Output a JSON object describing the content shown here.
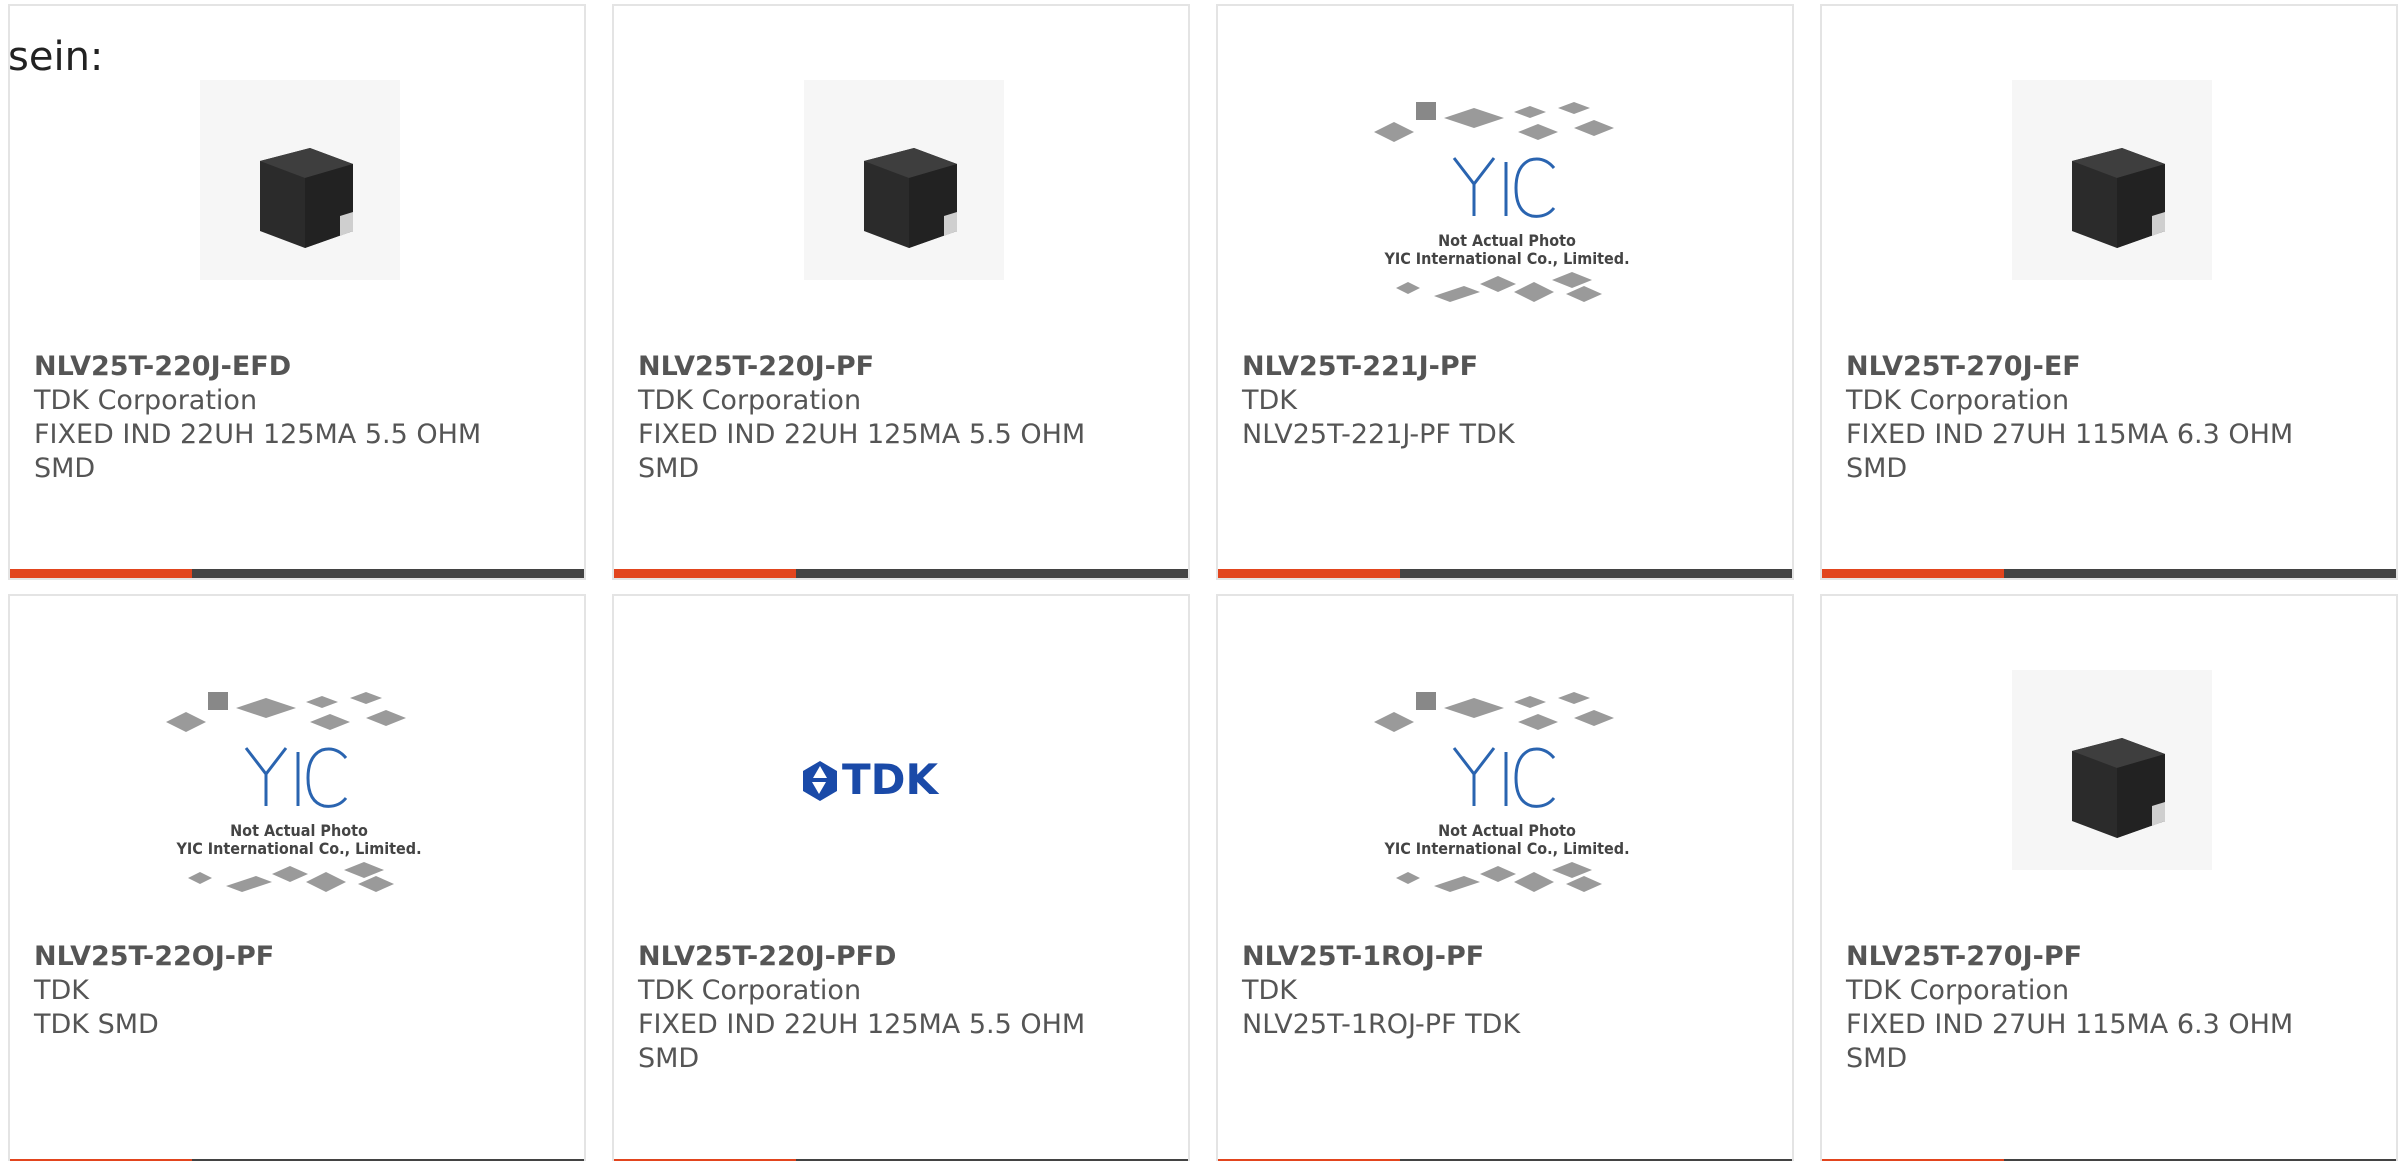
{
  "intro_text": "sein:",
  "accent_color": "#e2451e",
  "bar_color": "#434343",
  "cards": [
    {
      "part": "NLV25T-220J-EFD",
      "maker": "TDK Corporation",
      "desc": "FIXED IND 22UH 125MA 5.5 OHM SMD",
      "image": "inductor-chip-photo"
    },
    {
      "part": "NLV25T-220J-PF",
      "maker": "TDK Corporation",
      "desc": "FIXED IND 22UH 125MA 5.5 OHM SMD",
      "image": "inductor-chip-photo"
    },
    {
      "part": "NLV25T-221J-PF",
      "maker": "TDK",
      "desc": "NLV25T-221J-PF TDK",
      "image": "yic-placeholder",
      "placeholder_line1": "Not Actual Photo",
      "placeholder_line2": "YIC International Co., Limited."
    },
    {
      "part": "NLV25T-270J-EF",
      "maker": "TDK Corporation",
      "desc": "FIXED IND 27UH 115MA 6.3 OHM SMD",
      "image": "inductor-chip-photo"
    },
    {
      "part": "NLV25T-22OJ-PF",
      "maker": "TDK",
      "desc": "TDK SMD",
      "image": "yic-placeholder",
      "placeholder_line1": "Not Actual Photo",
      "placeholder_line2": "YIC International Co., Limited."
    },
    {
      "part": "NLV25T-220J-PFD",
      "maker": "TDK Corporation",
      "desc": "FIXED IND 22UH 125MA 5.5 OHM SMD",
      "image": "tdk-logo",
      "logo_text": "TDK"
    },
    {
      "part": "NLV25T-1ROJ-PF",
      "maker": "TDK",
      "desc": "NLV25T-1ROJ-PF TDK",
      "image": "yic-placeholder",
      "placeholder_line1": "Not Actual Photo",
      "placeholder_line2": "YIC International Co., Limited."
    },
    {
      "part": "NLV25T-270J-PF",
      "maker": "TDK Corporation",
      "desc": "FIXED IND 27UH 115MA 6.3 OHM SMD",
      "image": "inductor-chip-photo"
    }
  ]
}
